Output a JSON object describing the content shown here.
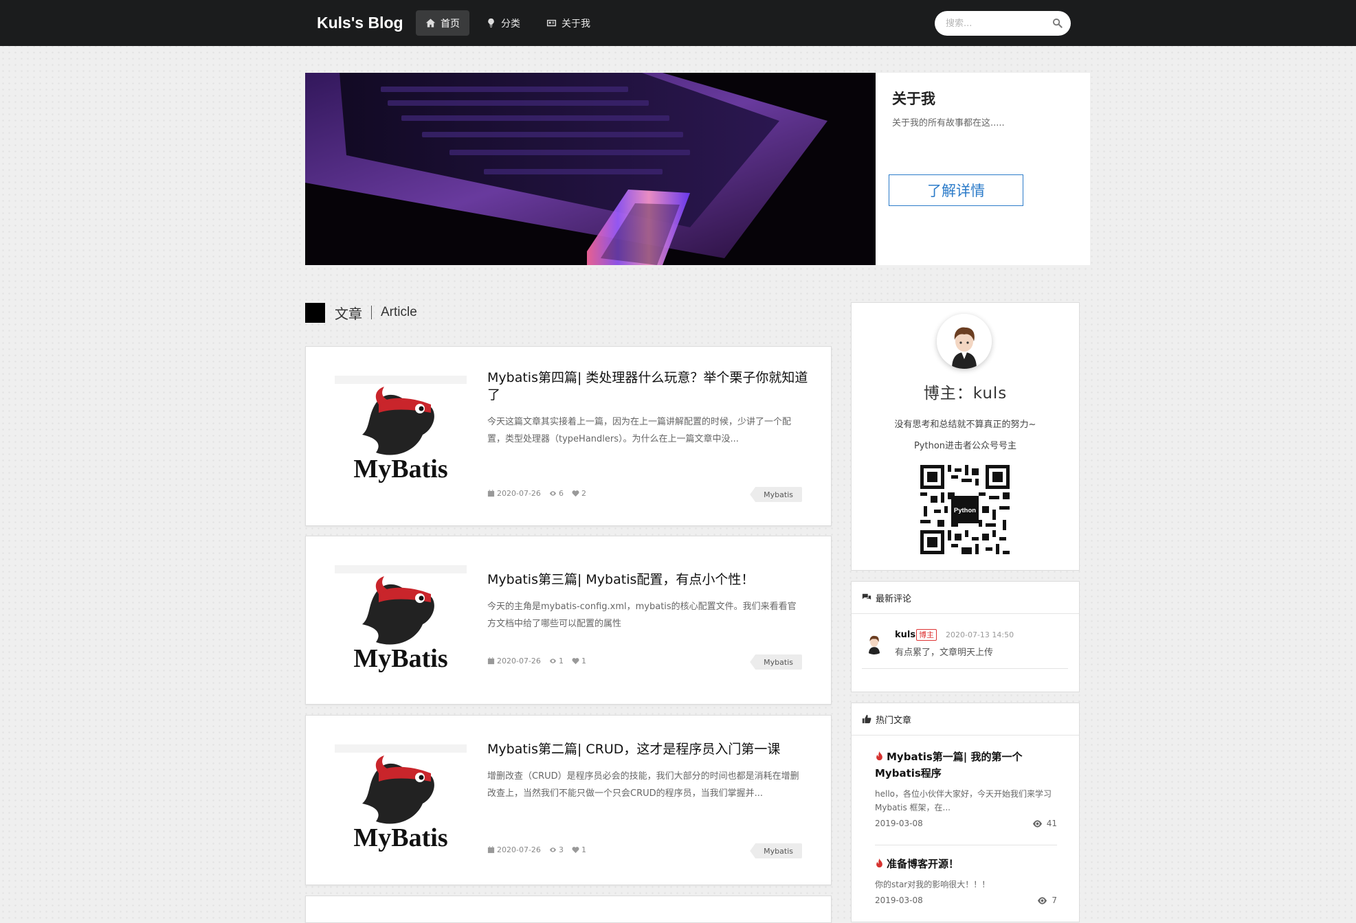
{
  "header": {
    "brand": "Kuls's Blog",
    "nav": [
      {
        "label": "首页",
        "icon": "home-icon",
        "active": true
      },
      {
        "label": "分类",
        "icon": "lightbulb-icon",
        "active": false
      },
      {
        "label": "关于我",
        "icon": "id-card-icon",
        "active": false
      }
    ],
    "search_placeholder": "搜索..."
  },
  "banner": {
    "about_title": "关于我",
    "about_desc": "关于我的所有故事都在这.....",
    "about_button": "了解详情"
  },
  "section": {
    "title_zh": "文章",
    "title_en": "Article"
  },
  "articles": [
    {
      "title": "Mybatis第四篇| 类处理器什么玩意？举个栗子你就知道了",
      "excerpt": "今天这篇文章其实接着上一篇，因为在上一篇讲解配置的时候，少讲了一个配置，类型处理器（typeHandlers）。为什么在上一篇文章中没...",
      "date": "2020-07-26",
      "views": "6",
      "likes": "2",
      "tag": "Mybatis"
    },
    {
      "title": "Mybatis第三篇| Mybatis配置，有点小个性！",
      "excerpt": "今天的主角是mybatis-config.xml，mybatis的核心配置文件。我们来看看官方文档中给了哪些可以配置的属性",
      "date": "2020-07-26",
      "views": "1",
      "likes": "1",
      "tag": "Mybatis"
    },
    {
      "title": "Mybatis第二篇| CRUD，这才是程序员入门第一课",
      "excerpt": "增删改查（CRUD）是程序员必会的技能，我们大部分的时间也都是消耗在增删改查上，当然我们不能只做一个只会CRUD的程序员，当我们掌握并...",
      "date": "2020-07-26",
      "views": "3",
      "likes": "1",
      "tag": "Mybatis"
    }
  ],
  "thumb_logo_text": "MyBatis",
  "profile": {
    "blogger": "博主：kuls",
    "motto": "没有思考和总结就不算真正的努力~",
    "owner": "Python进击者公众号号主",
    "qr_center_text": "Python"
  },
  "comments": {
    "title": "最新评论",
    "items": [
      {
        "name": "kuls",
        "badge": "博主",
        "time": "2020-07-13 14:50",
        "text": "有点累了，文章明天上传"
      }
    ]
  },
  "hot": {
    "title": "热门文章",
    "items": [
      {
        "title": "Mybatis第一篇| 我的第一个Mybatis程序",
        "excerpt": "hello，各位小伙伴大家好，今天开始我们来学习 Mybatis 框架，在...",
        "date": "2019-03-08",
        "views": "41"
      },
      {
        "title": "准备博客开源！",
        "excerpt": "你的star对我的影响很大！！！",
        "date": "2019-03-08",
        "views": "7"
      }
    ]
  }
}
